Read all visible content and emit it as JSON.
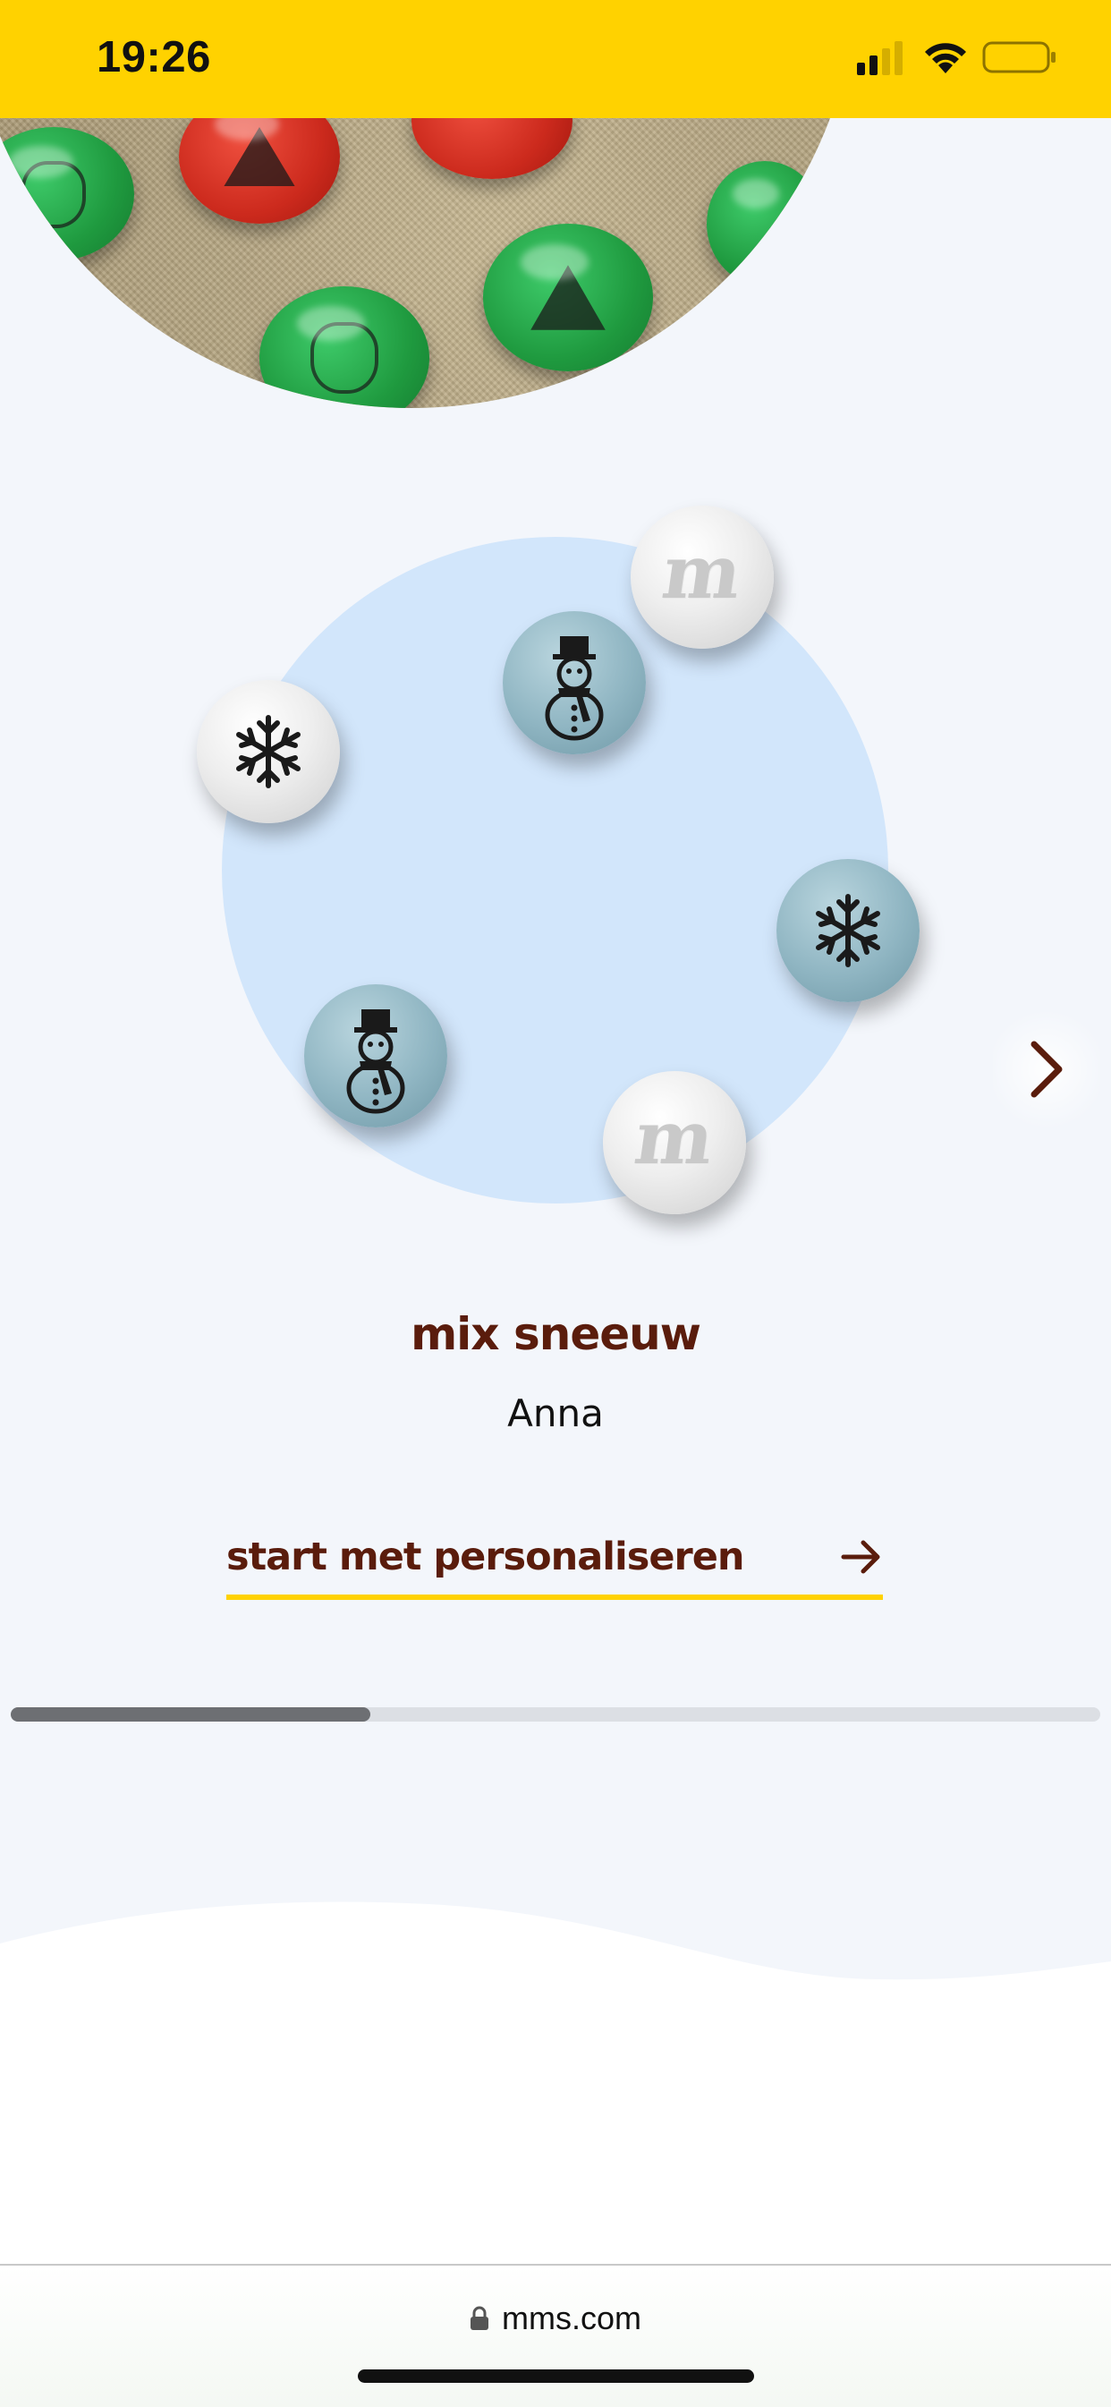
{
  "status_bar": {
    "time": "19:26",
    "background": "#ffd200"
  },
  "product": {
    "title": "mix sneeuw",
    "name": "Anna",
    "cta_label": "start met personaliseren",
    "carousel_progress": 0.33
  },
  "candies": [
    {
      "color": "white",
      "icon": "m-logo",
      "letter": "m"
    },
    {
      "color": "blue",
      "icon": "snowman-icon"
    },
    {
      "color": "white",
      "icon": "snowflake-icon"
    },
    {
      "color": "blue",
      "icon": "snowflake-icon"
    },
    {
      "color": "blue",
      "icon": "snowman-icon"
    },
    {
      "color": "white",
      "icon": "m-logo",
      "letter": "m"
    }
  ],
  "browser": {
    "url": "mms.com"
  },
  "colors": {
    "brand_brown": "#5a1c0c",
    "brand_yellow": "#ffd200",
    "circle_blue": "#d2e6fb"
  }
}
